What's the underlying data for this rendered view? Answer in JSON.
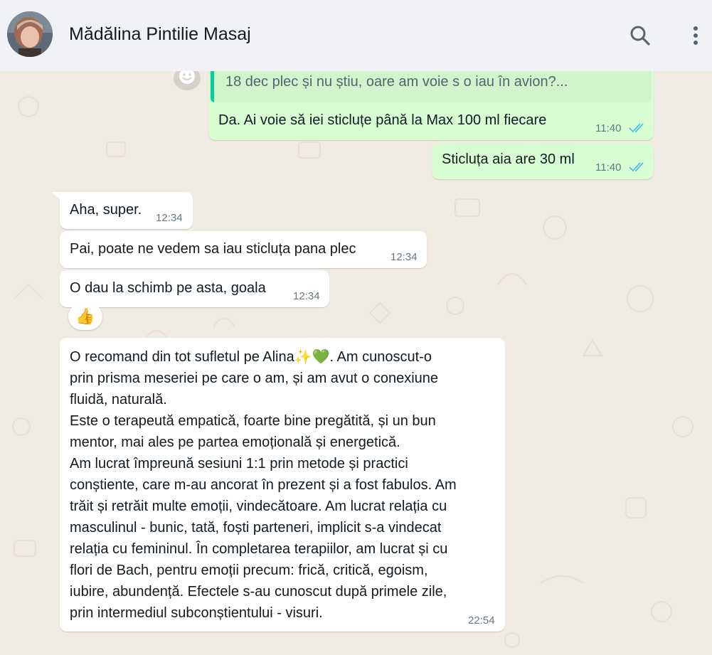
{
  "header": {
    "contact_name": "Mădălina Pintilie Masaj",
    "avatar_icon": "contact-avatar",
    "search_icon": "search-icon",
    "menu_icon": "kebab-menu-icon"
  },
  "colors": {
    "outgoing_bubble": "#d9fdd3",
    "incoming_bubble": "#ffffff",
    "chat_background": "#efeae2",
    "header_background": "#f0f2f5",
    "read_ticks": "#53bdeb",
    "quote_bar": "#06cf9c"
  },
  "messages": {
    "quoted": {
      "text": "18 dec plec și nu știu, oare am voie s o iau în avion?..."
    },
    "m1": {
      "text": "Da. Ai voie să iei sticluțe până la Max 100 ml fiecare",
      "time": "11:40",
      "status": "read"
    },
    "m2": {
      "text": "Sticluța aia are 30 ml",
      "time": "11:40",
      "status": "read"
    },
    "m3": {
      "text": "Aha, super.",
      "time": "12:34"
    },
    "m4": {
      "text": "Pai, poate ne vedem sa iau sticluța pana plec",
      "time": "12:34"
    },
    "m5": {
      "text": "O dau la schimb pe asta, goala",
      "time": "12:34",
      "reaction": "👍"
    },
    "m6": {
      "lines": [
        "O recomand din tot sufletul pe Alina✨💚. Am cunoscut-o",
        "prin prisma meseriei pe care o am, și am avut o conexiune",
        "fluidă, naturală.",
        "Este o terapeută empatică, foarte bine pregătită, și un bun",
        "mentor, mai ales pe partea emoțională și energetică.",
        "Am lucrat împreună sesiuni 1:1 prin metode și practici",
        "conștiente, care m-au ancorat în prezent și a fost fabulos. Am",
        "trăit și retrăit multe emoții, vindecătoare. Am lucrat relația cu",
        "masculinul - bunic, tată, foști parteneri, implicit s-a vindecat",
        "relația cu femininul. În completarea terapiilor, am lucrat și cu",
        "flori de Bach, pentru emoții precum: frică, critică, egoism,",
        "iubire, abundență. Efectele s-au cunoscut după primele zile,",
        "prin intermediul subconștientului - visuri."
      ],
      "time": "22:54"
    }
  }
}
